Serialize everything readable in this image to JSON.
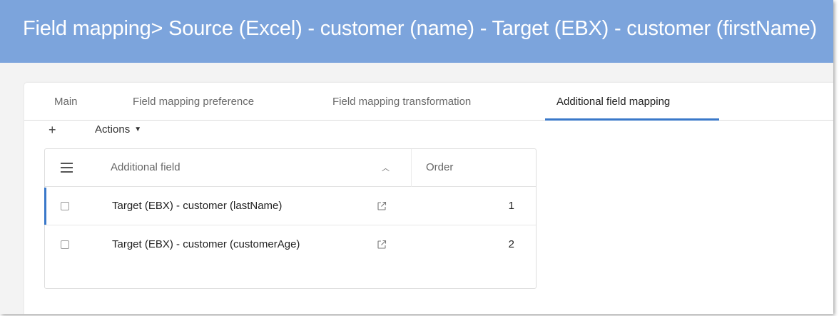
{
  "header": {
    "title": "Field mapping> Source (Excel) - customer (name) - Target (EBX) - customer (firstName)",
    "background_color": "#7ca4dc"
  },
  "tabs": [
    {
      "label": "Main",
      "active": false
    },
    {
      "label": "Field mapping preference",
      "active": false
    },
    {
      "label": "Field mapping transformation",
      "active": false
    },
    {
      "label": "Additional field mapping",
      "active": true
    }
  ],
  "toolbar": {
    "add_label": "+",
    "actions_label": "Actions"
  },
  "grid": {
    "columns": [
      "Additional field",
      "Order"
    ],
    "sort_icon": "chevron-up-icon",
    "rows": [
      {
        "field": "Target (EBX) - customer (lastName)",
        "order": "1",
        "checked": false
      },
      {
        "field": "Target (EBX) - customer (customerAge)",
        "order": "2",
        "checked": false
      }
    ]
  },
  "colors": {
    "accent": "#3a78c9"
  }
}
